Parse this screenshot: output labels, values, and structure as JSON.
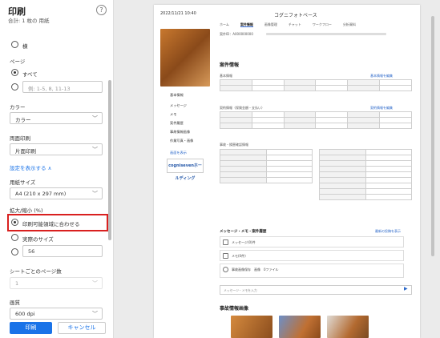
{
  "panel": {
    "title": "印刷",
    "subtitle": "合計: 1 枚の 用紙",
    "help_icon": "?",
    "orientation_option": "横",
    "pages_label": "ページ",
    "pages_all": "すべて",
    "pages_custom_placeholder": "例: 1-5, 8, 11-13",
    "color_label": "カラー",
    "color_value": "カラー",
    "duplex_label": "両面印刷",
    "duplex_value": "片面印刷",
    "settings_link": "設定を表示する ∧",
    "paper_label": "用紙サイズ",
    "paper_value": "A4 (210 x 297 mm)",
    "scale_label": "拡大/縮小 (%)",
    "scale_fit": "印刷可能領域に合わせる",
    "scale_actual": "実際のサイズ",
    "scale_custom_value": "56",
    "pages_per_sheet_label": "シートごとのページ数",
    "pages_per_sheet_value": "1",
    "quality_label": "画質",
    "quality_value": "600 dpi",
    "print_button": "印刷",
    "cancel_button": "キャンセル"
  },
  "preview": {
    "timestamp": "2022/11/21 10:40",
    "app_title": "コグニフォトベース",
    "tabs": [
      "ホーム",
      "案件情報",
      "画像管理",
      "チャット",
      "ワークフロー",
      "分析資料"
    ],
    "case_number": "案件ID：A000000000",
    "sidebar": [
      "基本情報",
      "メッセージ",
      "メモ",
      "案件履歴",
      "事故情報画像",
      "作業写真・画像"
    ],
    "side_link": "画面を表示",
    "logo": "cognisevenホールディング",
    "section_case": "案件情報",
    "sub_basic": "基本情報",
    "sub_contract": "契約情報（保険金額・支払い）",
    "sub_accident": "事故・損害確認情報",
    "edit_link": "基本情報を編集",
    "contract_link": "契約情報を編集",
    "chat_section": "メッセージ・メモ・案件履歴",
    "chat_link": "最新の投稿を表示",
    "msg1": "メッセージ(0)件",
    "msg2": "メモ(0件)",
    "msg3": "事故画像保存　画像　0ファイル",
    "chat_placeholder": "メッセージ・メモを入力",
    "section_images": "事故情報画像"
  }
}
